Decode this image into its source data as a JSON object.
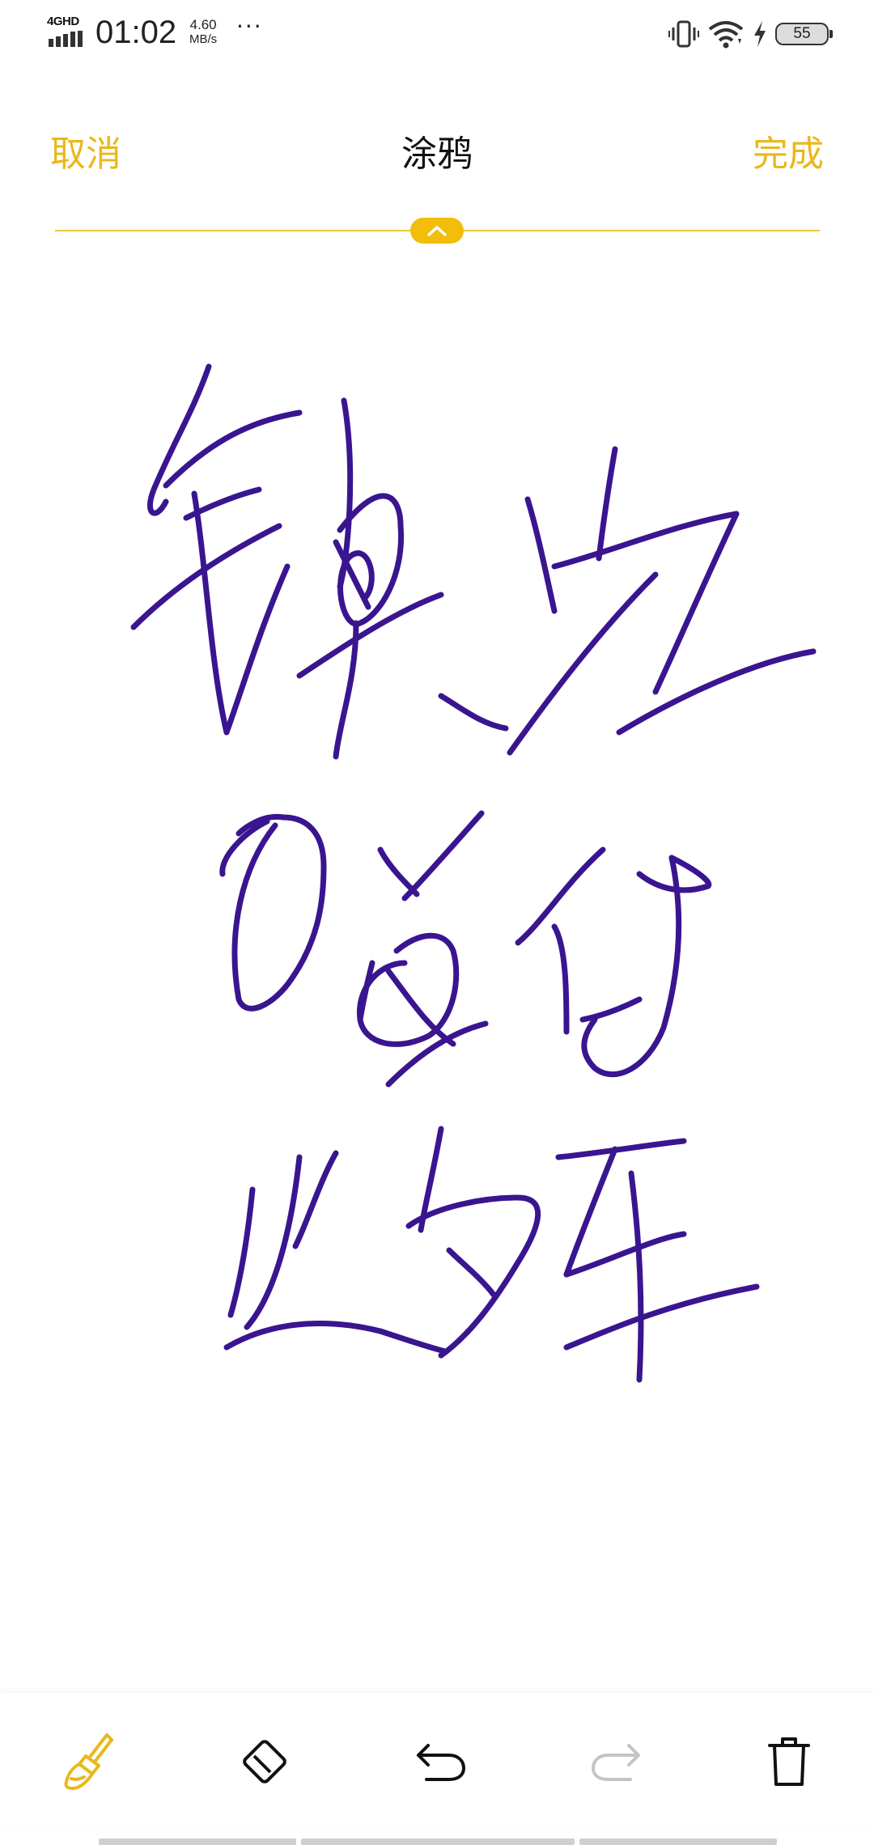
{
  "status_bar": {
    "network": "4GHD",
    "time": "01:02",
    "speed_value": "4.60",
    "speed_unit": "MB/s",
    "more": "···",
    "battery": "55",
    "icons": [
      "signal-icon",
      "vibrate-icon",
      "wifi-icon",
      "charging-icon",
      "battery-icon"
    ]
  },
  "header": {
    "cancel_label": "取消",
    "title": "涂鸦",
    "done_label": "完成"
  },
  "accent_color": "#E9B81A",
  "ink_color": "#3A1590",
  "toolbar": {
    "tools": [
      {
        "name": "brush",
        "icon": "brush-icon",
        "active": true
      },
      {
        "name": "eraser",
        "icon": "eraser-icon",
        "active": false
      },
      {
        "name": "undo",
        "icon": "undo-icon",
        "active": false
      },
      {
        "name": "redo",
        "icon": "redo-icon",
        "active": false
      },
      {
        "name": "delete",
        "icon": "trash-icon",
        "active": false
      }
    ]
  }
}
